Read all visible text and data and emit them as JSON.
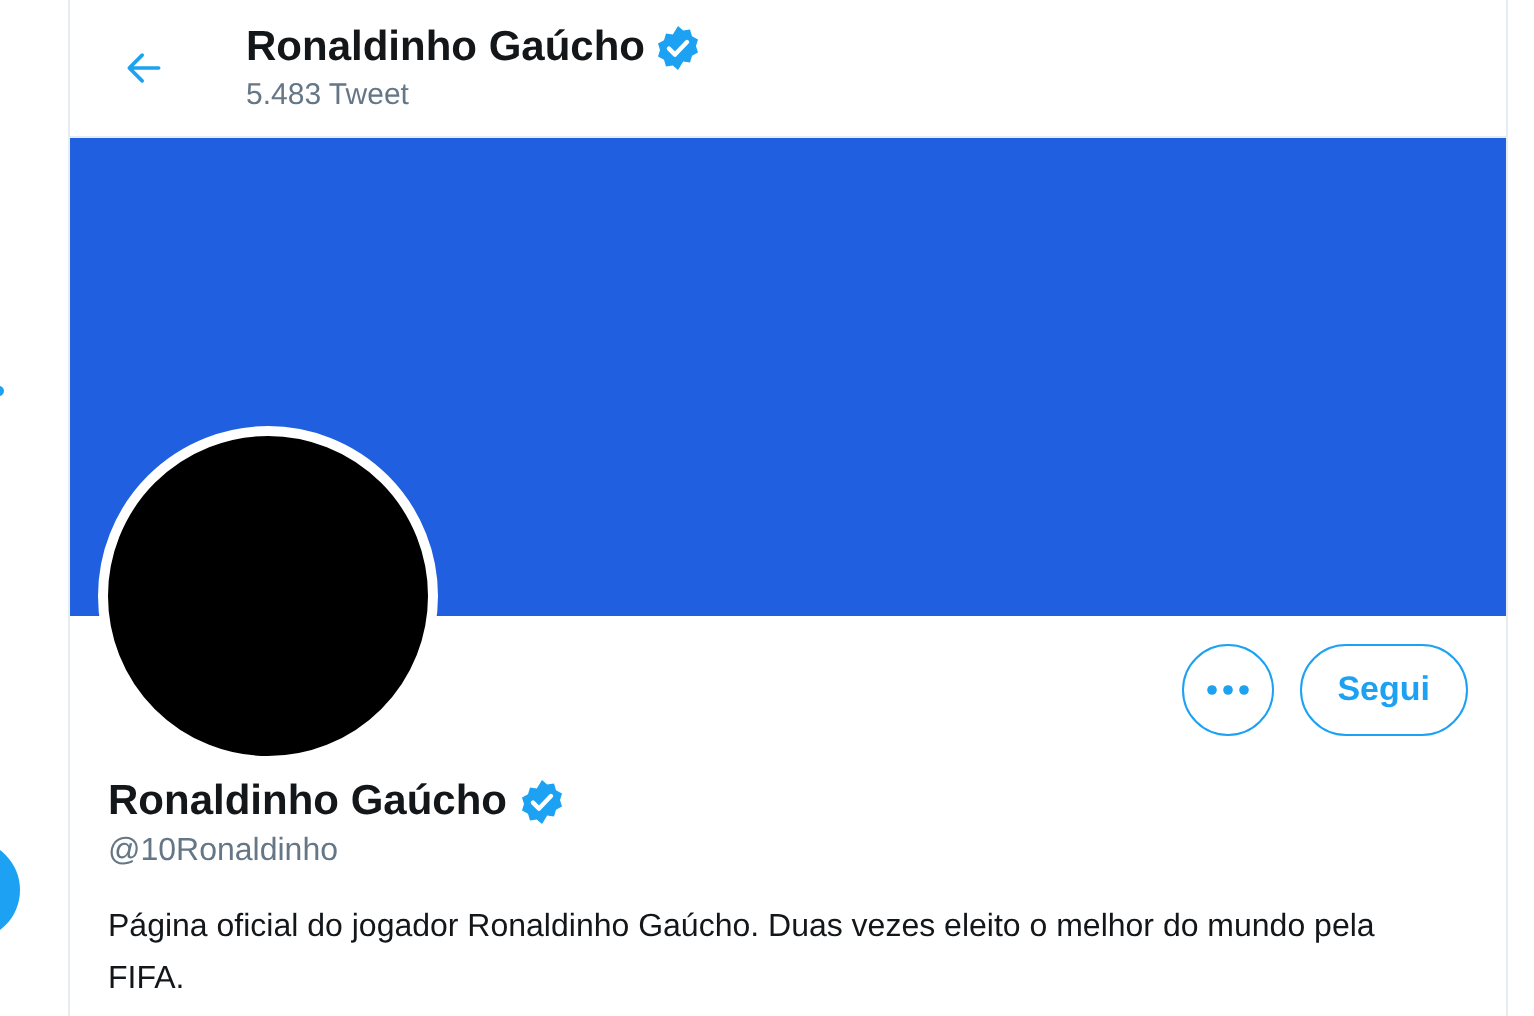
{
  "header": {
    "title": "Ronaldinho Gaúcho",
    "verified": true,
    "tweet_count": "5.483 Tweet"
  },
  "profile": {
    "name": "Ronaldinho Gaúcho",
    "verified": true,
    "handle": "@10Ronaldinho",
    "bio": "Página oficial do jogador Ronaldinho Gaúcho. Duas vezes eleito o melhor do mundo pela FIFA."
  },
  "follow_button": {
    "label": "Segui"
  }
}
